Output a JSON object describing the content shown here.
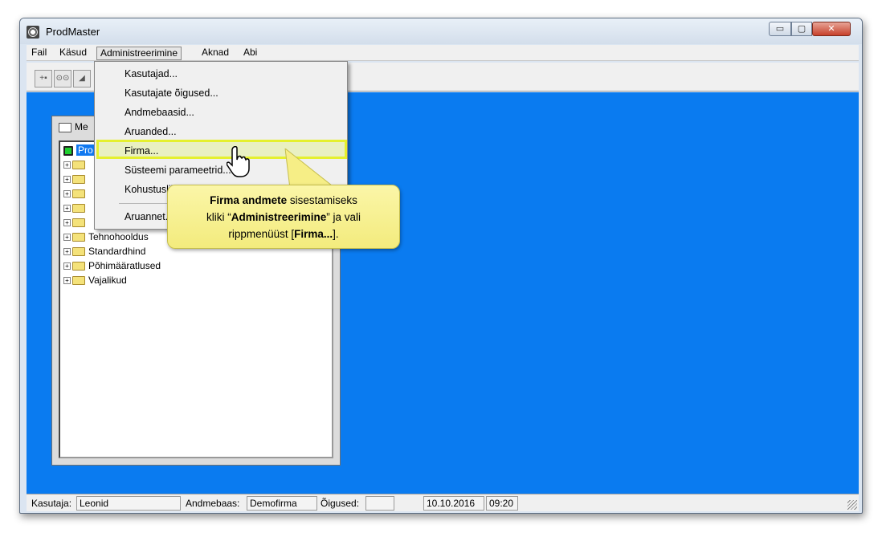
{
  "window": {
    "title": "ProdMaster",
    "min_label": "▭",
    "max_label": "▢",
    "close_label": "✕"
  },
  "menubar": {
    "items": [
      {
        "label": "Fail"
      },
      {
        "label": "Käsud"
      },
      {
        "label": "Administreerimine"
      },
      {
        "label": "Aknad"
      },
      {
        "label": "Abi"
      }
    ]
  },
  "dropdown": {
    "items": [
      {
        "label": "Kasutajad..."
      },
      {
        "label": "Kasutajate õigused..."
      },
      {
        "label": "Andmebaasid..."
      },
      {
        "label": "Aruanded..."
      },
      {
        "label": "Firma..."
      },
      {
        "label": "Süsteemi parameetrid..."
      },
      {
        "label": "Kohustuslik..."
      },
      {
        "label": "Aruannet..."
      }
    ]
  },
  "child_window": {
    "title": "Me"
  },
  "tree": {
    "root": "Pro",
    "items": [
      {
        "label": ""
      },
      {
        "label": ""
      },
      {
        "label": ""
      },
      {
        "label": ""
      },
      {
        "label": ""
      },
      {
        "label": "Tehnohooldus"
      },
      {
        "label": "Standardhind"
      },
      {
        "label": "Põhimääratlused"
      },
      {
        "label": "Vajalikud"
      }
    ]
  },
  "callout": {
    "bold1": "Firma andmete",
    "text1": " sisestamiseks",
    "text2": "kliki “",
    "bold2": "Administreerimine",
    "text3": "”  ja vali",
    "text4": "rippmenüüst  [",
    "bold3": "Firma...",
    "text5": "]."
  },
  "statusbar": {
    "user_label": "Kasutaja:",
    "user_value": "Leonid",
    "db_label": "Andmebaas:",
    "db_value": "Demofirma",
    "rights_label": "Õigused:",
    "rights_value": "",
    "date": "10.10.2016",
    "time": "09:20"
  },
  "colors": {
    "workspace": "#0a7bf0",
    "highlight": "#e5f02e",
    "callout": "#f7ef8a"
  }
}
